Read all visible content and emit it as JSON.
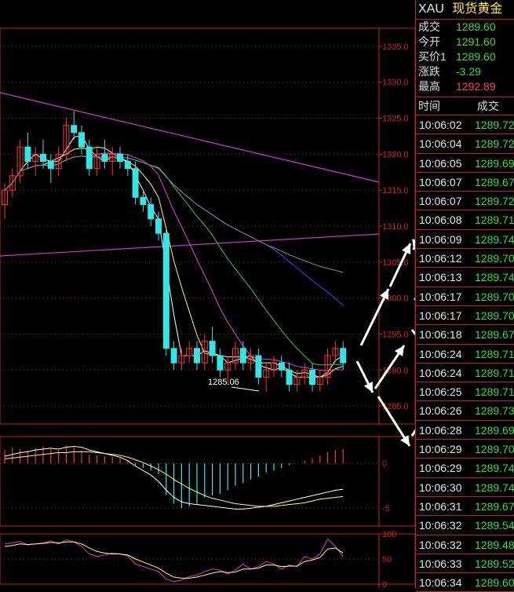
{
  "symbol": "XAU",
  "name": "现货黄金",
  "colors": {
    "up": "#ff3333",
    "down": "#33e6e6",
    "green": "#33dd33",
    "axis": "#cc2222"
  },
  "quotes": [
    {
      "label": "成交",
      "value": "1289.60",
      "color": "#33dd33"
    },
    {
      "label": "今开",
      "value": "1291.60",
      "color": "#33dd33"
    },
    {
      "label": "买价1",
      "value": "1289.60",
      "color": "#33dd33"
    },
    {
      "label": "涨跌",
      "value": "-3.29",
      "color": "#33dd33"
    },
    {
      "label": "最高",
      "value": "1292.89",
      "color": "#ff4444"
    }
  ],
  "tick_header": {
    "time": "时间",
    "price": "成交"
  },
  "ticks": [
    {
      "time": "10:06:02",
      "price": "1289.72"
    },
    {
      "time": "10:06:04",
      "price": "1289.72"
    },
    {
      "time": "10:06:05",
      "price": "1289.69"
    },
    {
      "time": "10:06:07",
      "price": "1289.67"
    },
    {
      "time": "10:06:07",
      "price": "1289.72"
    },
    {
      "time": "10:06:08",
      "price": "1289.71"
    },
    {
      "time": "10:06:09",
      "price": "1289.74"
    },
    {
      "time": "10:06:12",
      "price": "1289.70"
    },
    {
      "time": "10:06:13",
      "price": "1289.74"
    },
    {
      "time": "10:06:17",
      "price": "1289.70"
    },
    {
      "time": "10:06:17",
      "price": "1289.70"
    },
    {
      "time": "10:06:18",
      "price": "1289.67"
    },
    {
      "time": "10:06:24",
      "price": "1289.71"
    },
    {
      "time": "10:06:24",
      "price": "1289.71"
    },
    {
      "time": "10:06:25",
      "price": "1289.71"
    },
    {
      "time": "10:06:26",
      "price": "1289.73"
    },
    {
      "time": "10:06:28",
      "price": "1289.69"
    },
    {
      "time": "10:06:29",
      "price": "1289.70"
    },
    {
      "time": "10:06:29",
      "price": "1289.74"
    },
    {
      "time": "10:06:30",
      "price": "1289.74"
    },
    {
      "time": "10:06:31",
      "price": "1289.67"
    },
    {
      "time": "10:06:32",
      "price": "1289.54"
    },
    {
      "time": "10:06:32",
      "price": "1289.48"
    },
    {
      "time": "10:06:33",
      "price": "1289.52"
    },
    {
      "time": "10:06:34",
      "price": "1289.60"
    }
  ],
  "chart_data": [
    {
      "type": "candlestick",
      "y_ticks": [
        "1335.0",
        "1330.0",
        "1325.0",
        "1320.0",
        "1315.0",
        "1310.0",
        "1305.0",
        "1300.0",
        "1295.0",
        "1290.0",
        "1285.0"
      ],
      "ylim": [
        1282.5,
        1337.5
      ],
      "annotation": "1285.06",
      "candles": [
        [
          1313,
          1316,
          1311,
          1315
        ],
        [
          1315,
          1318,
          1314,
          1317
        ],
        [
          1317,
          1322,
          1316,
          1321
        ],
        [
          1321,
          1323,
          1318,
          1319
        ],
        [
          1319,
          1321,
          1317,
          1320
        ],
        [
          1320,
          1322,
          1318,
          1319
        ],
        [
          1319,
          1320,
          1316,
          1318
        ],
        [
          1318,
          1321,
          1317,
          1320
        ],
        [
          1320,
          1325,
          1319,
          1324
        ],
        [
          1324,
          1326,
          1322,
          1323
        ],
        [
          1323,
          1324,
          1320,
          1321
        ],
        [
          1321,
          1322,
          1317,
          1318
        ],
        [
          1318,
          1321,
          1317,
          1320
        ],
        [
          1320,
          1322,
          1318,
          1319
        ],
        [
          1319,
          1321,
          1317,
          1320
        ],
        [
          1320,
          1321,
          1318,
          1319
        ],
        [
          1319,
          1320,
          1317,
          1318
        ],
        [
          1318,
          1319,
          1313,
          1314
        ],
        [
          1314,
          1315,
          1312,
          1313
        ],
        [
          1313,
          1314,
          1310,
          1311
        ],
        [
          1311,
          1312,
          1308,
          1309
        ],
        [
          1309,
          1310,
          1292,
          1293
        ],
        [
          1293,
          1294,
          1290,
          1291
        ],
        [
          1291,
          1293,
          1290,
          1292
        ],
        [
          1292,
          1294,
          1291,
          1293
        ],
        [
          1293,
          1294,
          1290,
          1291
        ],
        [
          1291,
          1295,
          1290,
          1294
        ],
        [
          1294,
          1296,
          1291,
          1292
        ],
        [
          1292,
          1293,
          1289,
          1290
        ],
        [
          1290,
          1292,
          1288,
          1291
        ],
        [
          1291,
          1294,
          1290,
          1293
        ],
        [
          1293,
          1294,
          1290,
          1291
        ],
        [
          1291,
          1293,
          1290,
          1292
        ],
        [
          1292,
          1293,
          1288,
          1289
        ],
        [
          1289,
          1291,
          1287,
          1290
        ],
        [
          1290,
          1292,
          1289,
          1291
        ],
        [
          1291,
          1292,
          1289,
          1290
        ],
        [
          1290,
          1291,
          1287,
          1288
        ],
        [
          1288,
          1290,
          1287,
          1289
        ],
        [
          1289,
          1291,
          1288,
          1290
        ],
        [
          1290,
          1291,
          1287,
          1288
        ],
        [
          1288,
          1290,
          1287,
          1289
        ],
        [
          1289,
          1293,
          1288,
          1292
        ],
        [
          1292,
          1294,
          1291,
          1293
        ],
        [
          1293,
          1294,
          1290,
          1291
        ]
      ]
    },
    {
      "type": "macd",
      "y_ticks": [
        "0",
        "-5"
      ],
      "ylim": [
        -7,
        3
      ],
      "hist": [
        1.5,
        1.8,
        1.6,
        1.4,
        1.7,
        1.9,
        1.6,
        1.5,
        2.0,
        1.8,
        1.4,
        1.0,
        0.9,
        0.8,
        0.7,
        0.6,
        0.4,
        -0.2,
        -0.5,
        -0.8,
        -1.2,
        -3.5,
        -4.5,
        -5.0,
        -4.8,
        -4.5,
        -3.8,
        -3.6,
        -3.4,
        -3.0,
        -2.5,
        -2.2,
        -1.8,
        -1.5,
        -1.0,
        -0.8,
        -0.5,
        -0.2,
        0.0,
        0.3,
        0.6,
        0.9,
        1.3,
        1.5,
        1.6
      ],
      "dif": [
        0.8,
        1.0,
        1.2,
        1.3,
        1.5,
        1.6,
        1.7,
        1.6,
        1.8,
        1.9,
        1.8,
        1.5,
        1.3,
        1.1,
        0.9,
        0.7,
        0.3,
        -0.3,
        -0.8,
        -1.3,
        -2.0,
        -3.0,
        -3.8,
        -4.3,
        -4.5,
        -4.6,
        -4.7,
        -4.8,
        -4.9,
        -5.0,
        -5.1,
        -5.1,
        -5.0,
        -4.9,
        -4.8,
        -4.6,
        -4.4,
        -4.2,
        -4.0,
        -3.8,
        -3.6,
        -3.4,
        -3.2,
        -3.0,
        -2.9
      ],
      "dea": [
        0.5,
        0.6,
        0.7,
        0.8,
        0.9,
        1.0,
        1.1,
        1.2,
        1.2,
        1.3,
        1.3,
        1.3,
        1.2,
        1.1,
        1.0,
        0.9,
        0.7,
        0.4,
        0.1,
        -0.3,
        -0.7,
        -1.2,
        -1.8,
        -2.3,
        -2.8,
        -3.2,
        -3.6,
        -3.9,
        -4.1,
        -4.3,
        -4.5,
        -4.6,
        -4.7,
        -4.8,
        -4.8,
        -4.8,
        -4.7,
        -4.6,
        -4.5,
        -4.4,
        -4.2,
        -4.0,
        -3.9,
        -3.8,
        -3.7
      ]
    },
    {
      "type": "oscillator",
      "y_ticks": [
        "100",
        "50",
        "0"
      ],
      "ylim": [
        0,
        100
      ],
      "k": [
        80,
        82,
        85,
        78,
        80,
        82,
        86,
        80,
        88,
        84,
        75,
        60,
        55,
        58,
        62,
        60,
        56,
        40,
        35,
        30,
        25,
        10,
        5,
        8,
        15,
        18,
        25,
        30,
        28,
        20,
        28,
        40,
        30,
        35,
        45,
        40,
        30,
        38,
        35,
        55,
        50,
        60,
        90,
        75,
        55
      ],
      "d": [
        75,
        77,
        80,
        79,
        80,
        81,
        83,
        82,
        84,
        84,
        80,
        72,
        65,
        62,
        60,
        60,
        58,
        50,
        44,
        38,
        32,
        22,
        14,
        12,
        12,
        14,
        18,
        22,
        25,
        23,
        24,
        30,
        30,
        32,
        38,
        38,
        35,
        36,
        36,
        45,
        48,
        53,
        70,
        72,
        62
      ]
    }
  ]
}
